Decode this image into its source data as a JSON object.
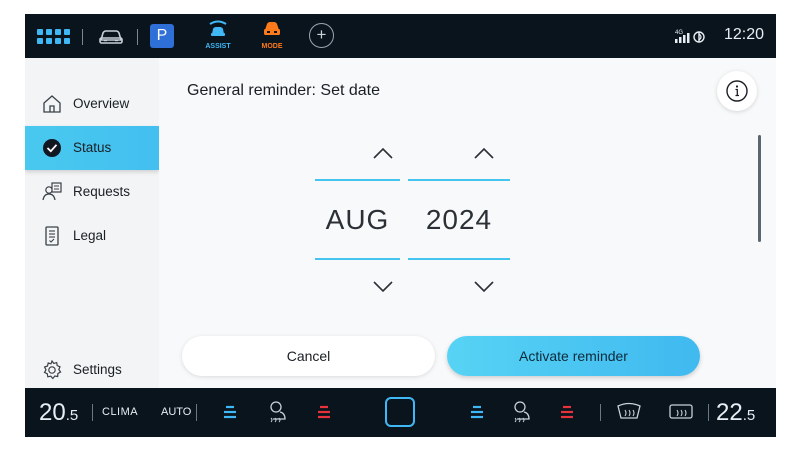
{
  "topbar": {
    "parking_label": "P",
    "assist_label": "ASSIST",
    "mode_label": "MODE",
    "add_label": "+",
    "network_label": "4G",
    "time": "12:20"
  },
  "sidebar": {
    "items": [
      {
        "label": "Overview",
        "icon": "home-icon"
      },
      {
        "label": "Status",
        "icon": "check-circle-icon",
        "active": true
      },
      {
        "label": "Requests",
        "icon": "person-list-icon"
      },
      {
        "label": "Legal",
        "icon": "document-icon"
      }
    ],
    "settings_label": "Settings"
  },
  "content": {
    "title": "General reminder: Set date",
    "month": "AUG",
    "year": "2024",
    "cancel_label": "Cancel",
    "activate_label": "Activate reminder"
  },
  "clima": {
    "left_temp_int": "20",
    "left_temp_dec": ".5",
    "clima_label": "CLIMA",
    "auto_label": "AUTO",
    "right_temp_int": "22",
    "right_temp_dec": ".5"
  },
  "colors": {
    "accent": "#45c4ef",
    "brand_blue": "#3fb8f5",
    "heat_red": "#e8323c",
    "mode_orange": "#ff7a1a"
  }
}
